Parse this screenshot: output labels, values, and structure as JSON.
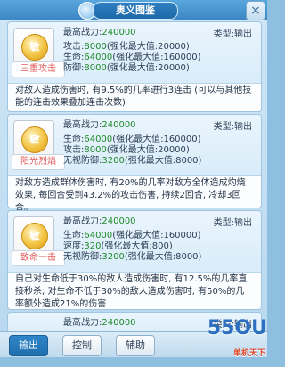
{
  "window": {
    "title": "奥义图鉴",
    "close_label": "×"
  },
  "skills": [
    {
      "name": "三重攻击",
      "icon_text": "敏",
      "max_power_label": "最高战力:",
      "max_power_value": "240000",
      "type_label": "类型:",
      "type_value": "输出",
      "stats": [
        {
          "label": "攻击:",
          "value": "8000",
          "suffix": "(强化最大值:20000)"
        },
        {
          "label": "生命:",
          "value": "64000",
          "suffix": "(强化最大值:160000)"
        },
        {
          "label": "防御:",
          "value": "8000",
          "suffix": "(强化最大值:20000)"
        }
      ],
      "description": "对敌人造成伤害时, 有9.5%的几率进行3连击 (可以与其他技能的连击效果叠加连击次数)"
    },
    {
      "name": "阳光烈焰",
      "icon_text": "敏",
      "max_power_label": "最高战力:",
      "max_power_value": "240000",
      "type_label": "类型:",
      "type_value": "输出",
      "stats": [
        {
          "label": "生命:",
          "value": "64000",
          "suffix": "(强化最大值:160000)"
        },
        {
          "label": "攻击:",
          "value": "8000",
          "suffix": "(强化最大值:20000)"
        },
        {
          "label": "无视防御:",
          "value": "3200",
          "suffix": "(强化最大值:8000)"
        }
      ],
      "description": "对敌方造成群体伤害时, 有20%的几率对敌方全体造成灼烧效果, 每回合受到43.2%的攻击伤害, 持续2回合, 冷却3回合。"
    },
    {
      "name": "致命一击",
      "icon_text": "敏",
      "max_power_label": "最高战力:",
      "max_power_value": "240000",
      "type_label": "类型:",
      "type_value": "输出",
      "stats": [
        {
          "label": "生命:",
          "value": "64000",
          "suffix": "(强化最大值:160000)"
        },
        {
          "label": "速度:",
          "value": "320",
          "suffix": "(强化最大值:800)"
        },
        {
          "label": "无视防御:",
          "value": "3200",
          "suffix": "(强化最大值:8000)"
        }
      ],
      "description": "自己对生命低于30%的敌人造成伤害时, 有12.5%的几率直接秒杀; 对生命不低于30%的敌人造成伤害时, 有50%的几率额外造成21%的伤害"
    },
    {
      "max_power_label": "最高战力:",
      "max_power_value": "240000",
      "type_label": "类型:",
      "type_value": "输出"
    }
  ],
  "tabs": [
    {
      "label": "输出",
      "active": true
    },
    {
      "label": "控制",
      "active": false
    },
    {
      "label": "辅助",
      "active": false
    }
  ],
  "watermark": {
    "main": "55OU",
    "sub": "单机天下"
  },
  "colors": {
    "accent": "#2f86c8",
    "value_green": "#1f8a2a",
    "skill_name_red": "#e05a5a"
  },
  "icons": {
    "title": "skill-book-icon",
    "close": "close-icon",
    "skill": "gold-coin-icon"
  }
}
